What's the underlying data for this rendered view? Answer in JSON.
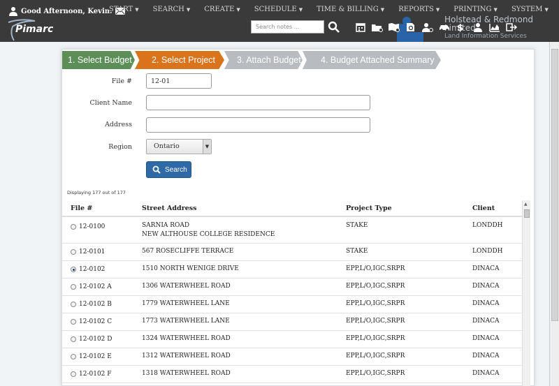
{
  "header": {
    "greeting": "Good Afternoon, Kevin.",
    "brand": "Pimarc",
    "menu": [
      {
        "label": "START"
      },
      {
        "label": "SEARCH"
      },
      {
        "label": "CREATE"
      },
      {
        "label": "SCHEDULE"
      },
      {
        "label": "TIME & BILLING"
      },
      {
        "label": "REPORTS"
      },
      {
        "label": "PRINTING"
      },
      {
        "label": "SYSTEM"
      }
    ],
    "search_placeholder": "Search notes ...",
    "company_name": "Holstead & Redmond Limited",
    "company_sub": "Land Information Services",
    "toolbar_icons": [
      "calendar-icon",
      "folder-search-icon",
      "map-search-icon",
      "document-search-icon",
      "user-search-icon",
      "car-icon",
      "money-icon",
      "person-icon",
      "chart-icon",
      "logout-icon"
    ]
  },
  "wizard": {
    "step1": "1. Select Budget",
    "step2": "2. Select Project",
    "step3": "3. Attach Budget",
    "step4": "4. Budget Attached Summary"
  },
  "form": {
    "file_label": "File #",
    "file_value": "12-01",
    "client_label": "Client Name",
    "client_value": "",
    "address_label": "Address",
    "address_value": "",
    "region_label": "Region",
    "region_value": "Ontario",
    "search_button": "Search"
  },
  "results": {
    "displaying": "Displaying 177 out of 177",
    "columns": {
      "file": "File #",
      "street": "Street Address",
      "type": "Project Type",
      "client": "Client"
    },
    "rows": [
      {
        "file": "12-0100",
        "street": "SARNIA ROAD",
        "street2": "NEW ALTHOUSE COLLEGE RESIDENCE",
        "type": "STAKE",
        "client": "LONDDH",
        "selected": false
      },
      {
        "file": "12-0101",
        "street": "567 ROSECLIFFE TERRACE",
        "street2": "",
        "type": "STAKE",
        "client": "LONDDH",
        "selected": false
      },
      {
        "file": "12-0102",
        "street": "1510 NORTH WENIGE DRIVE",
        "street2": "",
        "type": "EPP,L/O,IGC,SRPR",
        "client": "DINACA",
        "selected": true
      },
      {
        "file": "12-0102 A",
        "street": "1306 WATERWHEEL ROAD",
        "street2": "",
        "type": "EPP,L/O,IGC,SRPR",
        "client": "DINACA",
        "selected": false
      },
      {
        "file": "12-0102 B",
        "street": "1779 WATERWHEEL LANE",
        "street2": "",
        "type": "EPP,L/O,IGC,SRPR",
        "client": "DINACA",
        "selected": false
      },
      {
        "file": "12-0102 C",
        "street": "1773 WATERWHEEL LANE",
        "street2": "",
        "type": "EPP,L/O,IGC,SRPR",
        "client": "DINACA",
        "selected": false
      },
      {
        "file": "12-0102 D",
        "street": "1324 WATERWHEEL ROAD",
        "street2": "",
        "type": "EPP,L/O,IGC,SRPR",
        "client": "DINACA",
        "selected": false
      },
      {
        "file": "12-0102 E",
        "street": "1312 WATERWHEEL ROAD",
        "street2": "",
        "type": "EPP,L/O,IGC,SRPR",
        "client": "DINACA",
        "selected": false
      },
      {
        "file": "12-0102 F",
        "street": "1318 WATERWHEEL ROAD",
        "street2": "",
        "type": "EPP,L/O,IGC,SRPR",
        "client": "DINACA",
        "selected": false
      }
    ]
  }
}
